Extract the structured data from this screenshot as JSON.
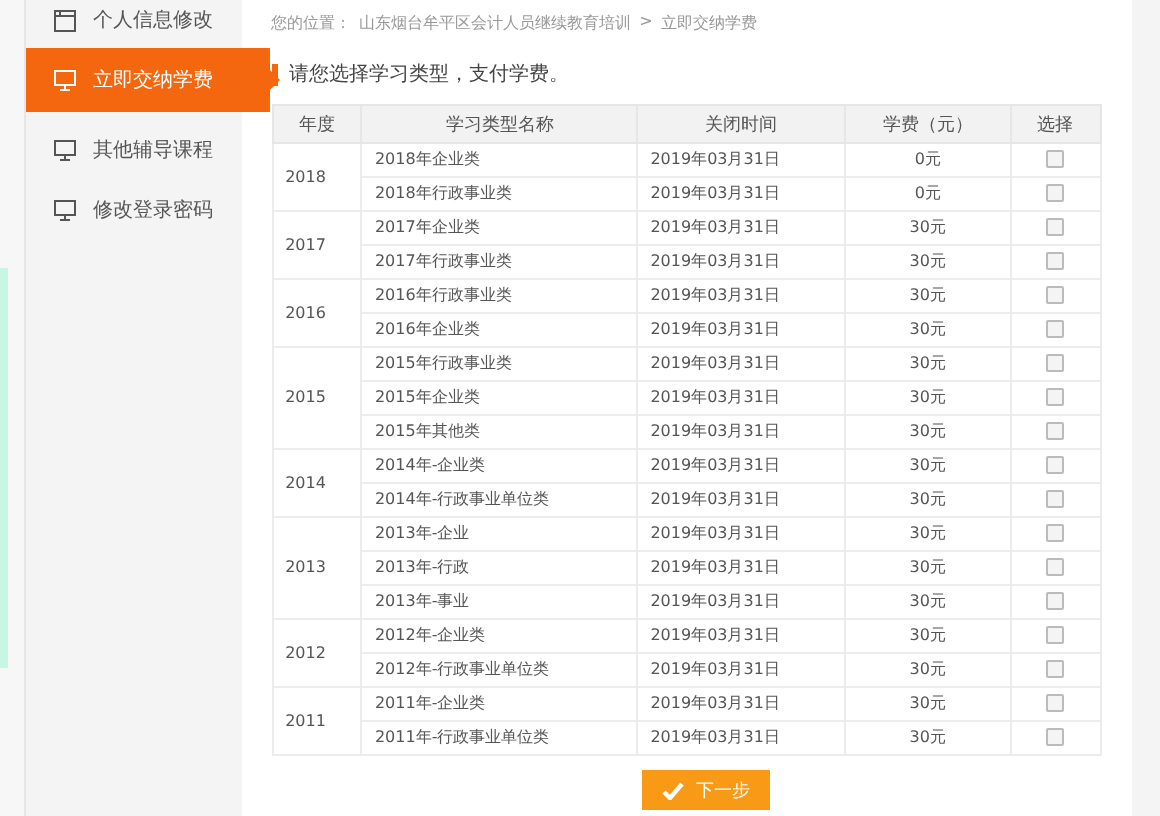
{
  "sidebar": {
    "items": [
      {
        "label": "个人信息修改",
        "kind": "form",
        "selected": false
      },
      {
        "label": "立即交纳学费",
        "kind": "monitor",
        "selected": true
      },
      {
        "label": "其他辅导课程",
        "kind": "monitor",
        "selected": false
      },
      {
        "label": "修改登录密码",
        "kind": "monitor",
        "selected": false
      }
    ]
  },
  "breadcrumb": {
    "prefix": "您的位置：",
    "items": [
      "山东烟台牟平区会计人员继续教育培训",
      "立即交纳学费"
    ],
    "separator": ">"
  },
  "heading": "请您选择学习类型，支付学费。",
  "table": {
    "columns": [
      "年度",
      "学习类型名称",
      "关闭时间",
      "学费（元）",
      "选择"
    ],
    "groups": [
      {
        "year": "2018",
        "rows": [
          {
            "name": "2018年企业类",
            "close": "2019年03月31日",
            "fee": "0元",
            "checked": false
          },
          {
            "name": "2018年行政事业类",
            "close": "2019年03月31日",
            "fee": "0元",
            "checked": false
          }
        ]
      },
      {
        "year": "2017",
        "rows": [
          {
            "name": "2017年企业类",
            "close": "2019年03月31日",
            "fee": "30元",
            "checked": false
          },
          {
            "name": "2017年行政事业类",
            "close": "2019年03月31日",
            "fee": "30元",
            "checked": false
          }
        ]
      },
      {
        "year": "2016",
        "rows": [
          {
            "name": "2016年行政事业类",
            "close": "2019年03月31日",
            "fee": "30元",
            "checked": false
          },
          {
            "name": "2016年企业类",
            "close": "2019年03月31日",
            "fee": "30元",
            "checked": false
          }
        ]
      },
      {
        "year": "2015",
        "rows": [
          {
            "name": "2015年行政事业类",
            "close": "2019年03月31日",
            "fee": "30元",
            "checked": false
          },
          {
            "name": "2015年企业类",
            "close": "2019年03月31日",
            "fee": "30元",
            "checked": false
          },
          {
            "name": "2015年其他类",
            "close": "2019年03月31日",
            "fee": "30元",
            "checked": false
          }
        ]
      },
      {
        "year": "2014",
        "rows": [
          {
            "name": "2014年-企业类",
            "close": "2019年03月31日",
            "fee": "30元",
            "checked": false
          },
          {
            "name": "2014年-行政事业单位类",
            "close": "2019年03月31日",
            "fee": "30元",
            "checked": false
          }
        ]
      },
      {
        "year": "2013",
        "rows": [
          {
            "name": "2013年-企业",
            "close": "2019年03月31日",
            "fee": "30元",
            "checked": false
          },
          {
            "name": "2013年-行政",
            "close": "2019年03月31日",
            "fee": "30元",
            "checked": false
          },
          {
            "name": "2013年-事业",
            "close": "2019年03月31日",
            "fee": "30元",
            "checked": false
          }
        ]
      },
      {
        "year": "2012",
        "rows": [
          {
            "name": "2012年-企业类",
            "close": "2019年03月31日",
            "fee": "30元",
            "checked": false
          },
          {
            "name": "2012年-行政事业单位类",
            "close": "2019年03月31日",
            "fee": "30元",
            "checked": false
          }
        ]
      },
      {
        "year": "2011",
        "rows": [
          {
            "name": "2011年-企业类",
            "close": "2019年03月31日",
            "fee": "30元",
            "checked": false
          },
          {
            "name": "2011年-行政事业单位类",
            "close": "2019年03月31日",
            "fee": "30元",
            "checked": false
          }
        ]
      }
    ]
  },
  "next_button": "下一步"
}
